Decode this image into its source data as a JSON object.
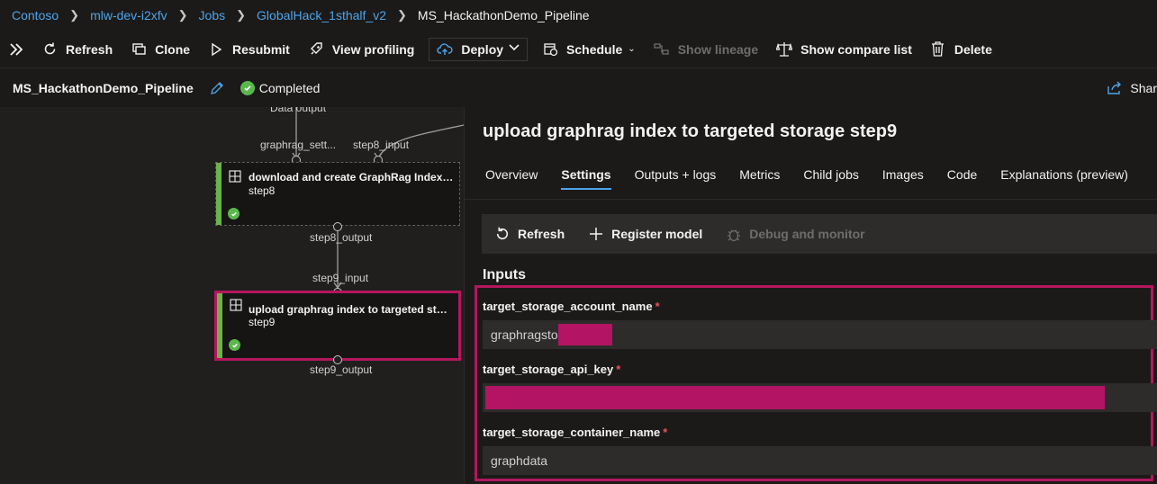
{
  "breadcrumb": {
    "items": [
      "Contoso",
      "mlw-dev-i2xfv",
      "Jobs",
      "GlobalHack_1sthalf_v2"
    ],
    "current": "MS_HackathonDemo_Pipeline"
  },
  "toolbar": {
    "refresh": "Refresh",
    "clone": "Clone",
    "resubmit": "Resubmit",
    "view_profiling": "View profiling",
    "deploy": "Deploy",
    "schedule": "Schedule",
    "show_lineage": "Show lineage",
    "show_compare_list": "Show compare list",
    "delete": "Delete"
  },
  "title_row": {
    "pipeline_name": "MS_HackathonDemo_Pipeline",
    "status": "Completed",
    "share": "Shar"
  },
  "canvas": {
    "top_label": "Data output",
    "step8_inputs": [
      "graphrag_sett...",
      "step8_input"
    ],
    "step8": {
      "title": "download and create GraphRag Index st...",
      "step": "step8",
      "output": "step8_output"
    },
    "step9_input": "step9_input",
    "step9": {
      "title": "upload graphrag index to targeted stora...",
      "step": "step9",
      "output": "step9_output"
    }
  },
  "panel": {
    "title": "upload graphrag index to targeted storage step9",
    "tabs": [
      "Overview",
      "Settings",
      "Outputs + logs",
      "Metrics",
      "Child jobs",
      "Images",
      "Code",
      "Explanations (preview)"
    ],
    "active_tab": "Settings",
    "sub_toolbar": {
      "refresh": "Refresh",
      "register_model": "Register model",
      "debug_monitor": "Debug and monitor"
    },
    "inputs_heading": "Inputs",
    "fields": [
      {
        "label": "target_storage_account_name",
        "required": "*",
        "value": "graphragsto"
      },
      {
        "label": "target_storage_api_key",
        "required": "*",
        "value": ""
      },
      {
        "label": "target_storage_container_name",
        "required": "*",
        "value": "graphdata"
      }
    ]
  },
  "colors": {
    "link": "#4fa3e8",
    "success": "#59b84c",
    "highlight": "#b4165e",
    "redaction": "#b31463"
  }
}
